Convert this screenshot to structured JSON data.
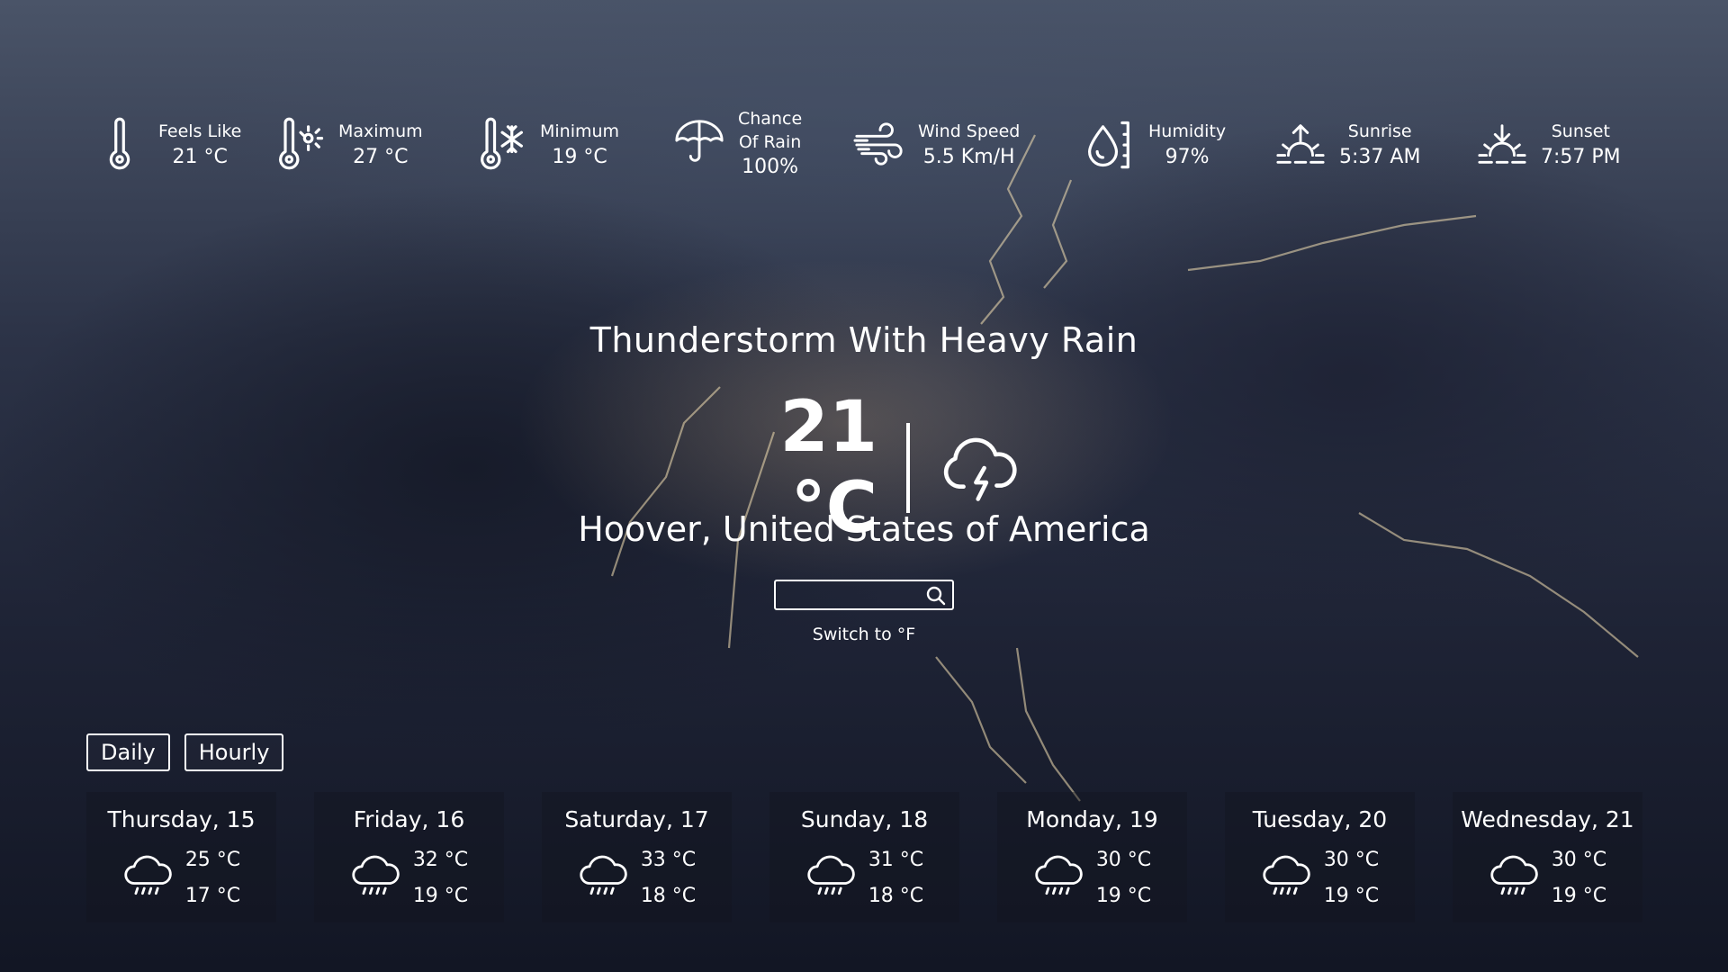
{
  "stats": [
    {
      "label": "Feels Like",
      "value": "21 °C",
      "icon": "thermometer-icon"
    },
    {
      "label": "Maximum",
      "value": "27 °C",
      "icon": "thermometer-sun-icon"
    },
    {
      "label": "Minimum",
      "value": "19 °C",
      "icon": "thermometer-snow-icon"
    },
    {
      "label_line1": "Chance",
      "label_line2": "Of Rain",
      "value": "100%",
      "icon": "umbrella-icon"
    },
    {
      "label": "Wind Speed",
      "value": "5.5 Km/H",
      "icon": "wind-icon"
    },
    {
      "label": "Humidity",
      "value": "97%",
      "icon": "humidity-icon"
    },
    {
      "label": "Sunrise",
      "value": "5:37 AM",
      "icon": "sunrise-icon"
    },
    {
      "label": "Sunset",
      "value": "7:57 PM",
      "icon": "sunset-icon"
    }
  ],
  "current": {
    "condition": "Thunderstorm With Heavy Rain",
    "temperature": "21 °C",
    "icon": "thunderstorm-cloud-icon",
    "location": "Hoover, United States of America"
  },
  "search": {
    "placeholder": "",
    "value": ""
  },
  "switch_label": "Switch to °F",
  "tabs": [
    "Daily",
    "Hourly"
  ],
  "forecast": [
    {
      "day": "Thursday, 15",
      "high": "25 °C",
      "low": "17 °C",
      "icon": "rain-cloud-icon"
    },
    {
      "day": "Friday, 16",
      "high": "32 °C",
      "low": "19 °C",
      "icon": "rain-cloud-icon"
    },
    {
      "day": "Saturday, 17",
      "high": "33 °C",
      "low": "18 °C",
      "icon": "rain-cloud-icon"
    },
    {
      "day": "Sunday, 18",
      "high": "31 °C",
      "low": "18 °C",
      "icon": "rain-cloud-icon"
    },
    {
      "day": "Monday, 19",
      "high": "30 °C",
      "low": "19 °C",
      "icon": "rain-cloud-icon"
    },
    {
      "day": "Tuesday, 20",
      "high": "30 °C",
      "low": "19 °C",
      "icon": "rain-cloud-icon"
    },
    {
      "day": "Wednesday, 21",
      "high": "30 °C",
      "low": "19 °C",
      "icon": "rain-cloud-icon"
    }
  ]
}
